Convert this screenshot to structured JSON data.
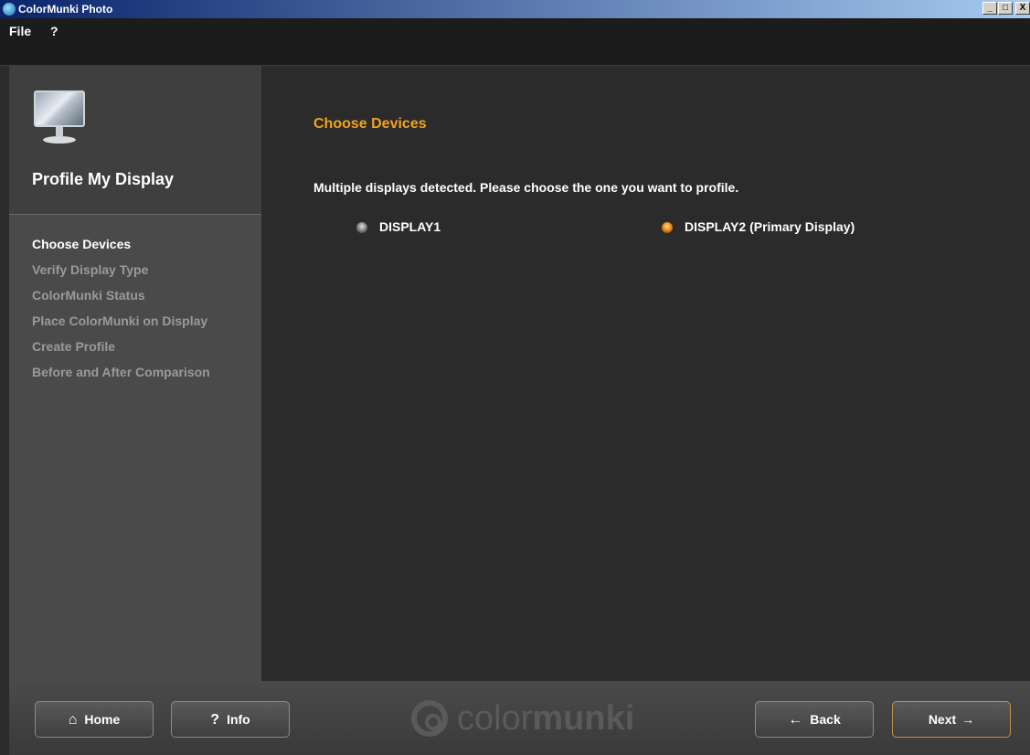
{
  "window": {
    "title": "ColorMunki Photo",
    "controls": [
      "_",
      "□",
      "X"
    ]
  },
  "menu": {
    "items": [
      "File",
      "?"
    ]
  },
  "sidebar": {
    "section_title": "Profile My Display",
    "steps": [
      {
        "label": "Choose Devices",
        "active": true
      },
      {
        "label": "Verify Display Type",
        "active": false
      },
      {
        "label": "ColorMunki Status",
        "active": false
      },
      {
        "label": "Place ColorMunki on Display",
        "active": false
      },
      {
        "label": "Create Profile",
        "active": false
      },
      {
        "label": "Before and After Comparison",
        "active": false
      }
    ]
  },
  "main": {
    "heading": "Choose Devices",
    "instruction": "Multiple displays detected. Please choose the one you want to profile.",
    "options": [
      {
        "label": "DISPLAY1",
        "selected": false
      },
      {
        "label": "DISPLAY2 (Primary Display)",
        "selected": true
      }
    ]
  },
  "footer": {
    "home_label": "Home",
    "info_label": "Info",
    "back_label": "Back",
    "next_label": "Next",
    "brand_light": "color",
    "brand_bold": "munki"
  },
  "colors": {
    "accent": "#f0a21c",
    "background": "#2b2b2b",
    "sidebar": "#4a4a4a"
  }
}
